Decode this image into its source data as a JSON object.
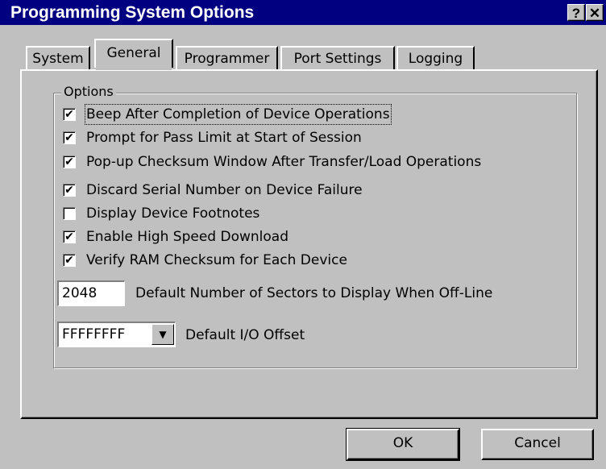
{
  "window": {
    "title": "Programming System Options",
    "help_glyph": "?",
    "close_glyph": "✕"
  },
  "tabs": [
    {
      "label": "System",
      "active": false
    },
    {
      "label": "General",
      "active": true
    },
    {
      "label": "Programmer",
      "active": false
    },
    {
      "label": "Port Settings",
      "active": false
    },
    {
      "label": "Logging",
      "active": false
    }
  ],
  "options": {
    "group_label": "Options",
    "checkboxes": [
      {
        "label": "Beep After Completion of Device Operations",
        "checked": true,
        "mark": "✔"
      },
      {
        "label": "Prompt for Pass Limit at Start of Session",
        "checked": true,
        "mark": "✔"
      },
      {
        "label": "Pop-up Checksum Window After Transfer/Load Operations",
        "checked": true,
        "mark": "✔"
      },
      {
        "label": "Discard Serial Number on Device Failure",
        "checked": true,
        "mark": "✔"
      },
      {
        "label": "Display Device Footnotes",
        "checked": false,
        "mark": ""
      },
      {
        "label": "Enable High Speed Download",
        "checked": true,
        "mark": "✔"
      },
      {
        "label": "Verify RAM Checksum for Each Device",
        "checked": true,
        "mark": "✔"
      }
    ],
    "sectors": {
      "value": "2048",
      "label": "Default Number of Sectors to Display When Off-Line"
    },
    "io_offset": {
      "value": "FFFFFFFF",
      "label": "Default I/O Offset",
      "arrow": "▼"
    }
  },
  "buttons": {
    "ok": "OK",
    "cancel": "Cancel"
  }
}
